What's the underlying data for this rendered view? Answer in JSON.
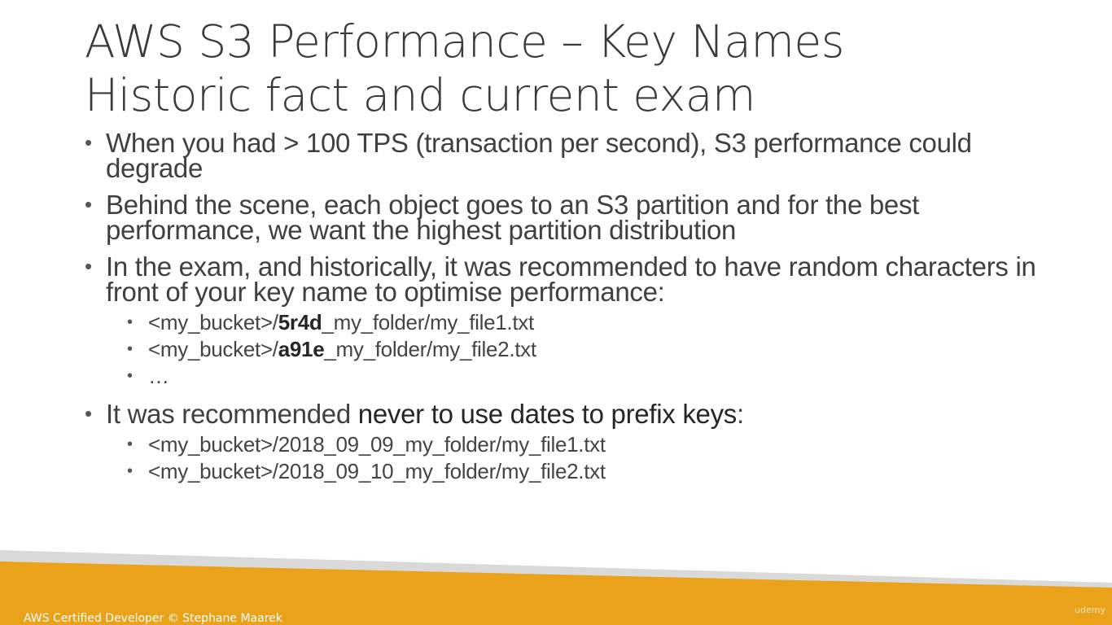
{
  "title": {
    "line1": "AWS S3 Performance – Key Names",
    "line2": "Historic fact and current exam"
  },
  "bullets": [
    {
      "text": "When you had > 100 TPS (transaction per second), S3 performance could degrade"
    },
    {
      "text": "Behind the scene, each object goes to an S3 partition and for the best performance, we want the highest partition distribution"
    },
    {
      "text": "In the exam, and historically, it was recommended to have random characters in front of your key name to optimise performance:",
      "sub": [
        {
          "pre": "<my_bucket>/",
          "bold": "5r4d",
          "post": "_my_folder/my_file1.txt"
        },
        {
          "pre": "<my_bucket>/",
          "bold": "a91e",
          "post": "_my_folder/my_file2.txt"
        },
        {
          "pre": "…",
          "bold": "",
          "post": ""
        }
      ]
    },
    {
      "pre": "It was recommended ",
      "bold": "never to use dates to prefix keys",
      "post": ":",
      "sub": [
        {
          "text": "<my_bucket>/2018_09_09_my_folder/my_file1.txt"
        },
        {
          "text": "<my_bucket>/2018_09_10_my_folder/my_file2.txt"
        }
      ]
    }
  ],
  "footer": {
    "credit": "AWS Certified Developer © Stephane Maarek",
    "watermark": "udemy"
  },
  "colors": {
    "footer_band": "#E9A21A",
    "footer_stripe": "#D9D9D9",
    "title_text": "#3A3A3A"
  }
}
